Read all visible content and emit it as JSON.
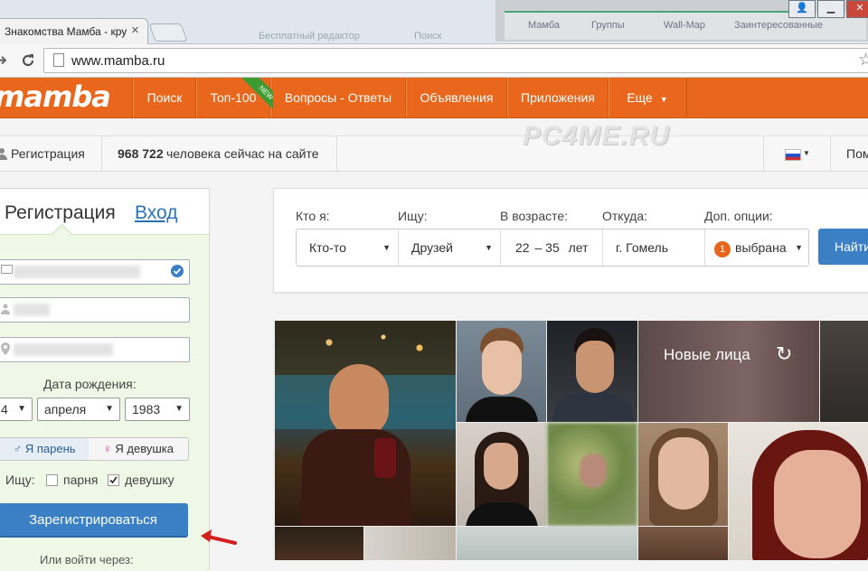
{
  "browser": {
    "tab_title": "Знакомства Мамба - кру",
    "tab_close": "×",
    "url": "www.mamba.ru",
    "star_icon": "☆",
    "window_buttons": [
      "👤",
      "▁",
      "✕"
    ],
    "background_window_text": [
      "Мамба",
      "Группы",
      "Wall-Map",
      "Заинтересованные",
      "Бесплатный редактор",
      "Поиск"
    ]
  },
  "header": {
    "logo": "mamba",
    "nav": [
      "Поиск",
      "Топ-100",
      "Вопросы - Ответы",
      "Объявления",
      "Приложения",
      "Еще"
    ],
    "new_badge": "NEW",
    "more_arrow": "▼"
  },
  "subbar": {
    "registration": "Регистрация",
    "online_count": "968 722",
    "online_text": "человека сейчас на сайте",
    "lang_arrow": "▼",
    "help_cut": "Пом",
    "watermark": "PC4ME.RU"
  },
  "registration": {
    "title": "Регистрация",
    "login_link": "Вход",
    "dob_label": "Дата рождения:",
    "dob_day": "4",
    "dob_month": "апреля",
    "dob_year": "1983",
    "gender_male": "Я парень",
    "gender_female": "Я девушка",
    "seek_label": "Ищу:",
    "seek_men": "парня",
    "seek_women": "девушку",
    "submit": "Зарегистрироваться",
    "alt_login": "Или войти через:"
  },
  "search": {
    "who_label": "Кто я:",
    "who_value": "Кто-то",
    "seek_label": "Ищу:",
    "seek_value": "Друзей",
    "age_label": "В возрасте:",
    "age_from": "22",
    "age_to": "35",
    "age_unit": "лет",
    "from_label": "Откуда:",
    "from_value": "г. Гомель",
    "options_label": "Доп. опции:",
    "options_count": "1",
    "options_value": "выбрана",
    "find_button": "Найти"
  },
  "grid": {
    "new_faces": "Новые лица",
    "refresh_icon": "↻"
  },
  "colors": {
    "brand_orange": "#e8671c",
    "button_blue": "#3b7fc4",
    "form_green": "#eff8e6"
  }
}
